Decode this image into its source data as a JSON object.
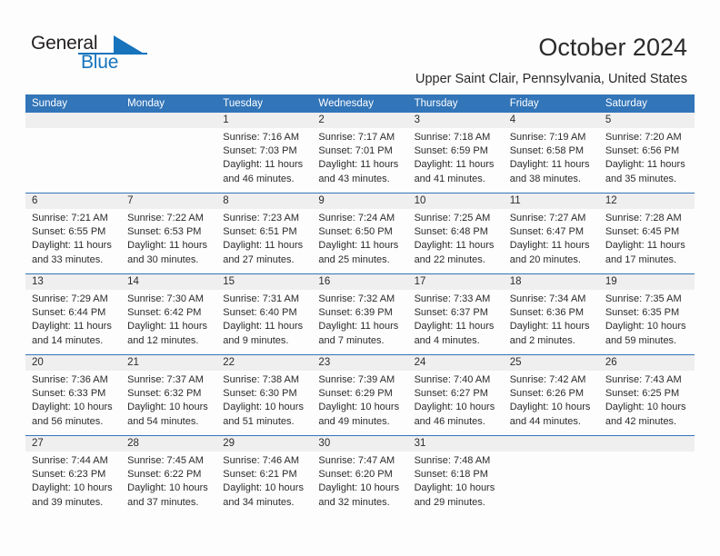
{
  "brand": {
    "name_part1": "General",
    "name_part2": "Blue"
  },
  "header": {
    "title": "October 2024",
    "location": "Upper Saint Clair, Pennsylvania, United States"
  },
  "colors": {
    "header_blue": "#3275b8",
    "brand_blue": "#1673bc",
    "daynum_strip": "#efefef",
    "text": "#2b2b2b"
  },
  "weekdays": [
    "Sunday",
    "Monday",
    "Tuesday",
    "Wednesday",
    "Thursday",
    "Friday",
    "Saturday"
  ],
  "weeks": [
    [
      {
        "day": "",
        "sunrise": "",
        "sunset": "",
        "daylight_1": "",
        "daylight_2": ""
      },
      {
        "day": "",
        "sunrise": "",
        "sunset": "",
        "daylight_1": "",
        "daylight_2": ""
      },
      {
        "day": "1",
        "sunrise": "Sunrise: 7:16 AM",
        "sunset": "Sunset: 7:03 PM",
        "daylight_1": "Daylight: 11 hours",
        "daylight_2": "and 46 minutes."
      },
      {
        "day": "2",
        "sunrise": "Sunrise: 7:17 AM",
        "sunset": "Sunset: 7:01 PM",
        "daylight_1": "Daylight: 11 hours",
        "daylight_2": "and 43 minutes."
      },
      {
        "day": "3",
        "sunrise": "Sunrise: 7:18 AM",
        "sunset": "Sunset: 6:59 PM",
        "daylight_1": "Daylight: 11 hours",
        "daylight_2": "and 41 minutes."
      },
      {
        "day": "4",
        "sunrise": "Sunrise: 7:19 AM",
        "sunset": "Sunset: 6:58 PM",
        "daylight_1": "Daylight: 11 hours",
        "daylight_2": "and 38 minutes."
      },
      {
        "day": "5",
        "sunrise": "Sunrise: 7:20 AM",
        "sunset": "Sunset: 6:56 PM",
        "daylight_1": "Daylight: 11 hours",
        "daylight_2": "and 35 minutes."
      }
    ],
    [
      {
        "day": "6",
        "sunrise": "Sunrise: 7:21 AM",
        "sunset": "Sunset: 6:55 PM",
        "daylight_1": "Daylight: 11 hours",
        "daylight_2": "and 33 minutes."
      },
      {
        "day": "7",
        "sunrise": "Sunrise: 7:22 AM",
        "sunset": "Sunset: 6:53 PM",
        "daylight_1": "Daylight: 11 hours",
        "daylight_2": "and 30 minutes."
      },
      {
        "day": "8",
        "sunrise": "Sunrise: 7:23 AM",
        "sunset": "Sunset: 6:51 PM",
        "daylight_1": "Daylight: 11 hours",
        "daylight_2": "and 27 minutes."
      },
      {
        "day": "9",
        "sunrise": "Sunrise: 7:24 AM",
        "sunset": "Sunset: 6:50 PM",
        "daylight_1": "Daylight: 11 hours",
        "daylight_2": "and 25 minutes."
      },
      {
        "day": "10",
        "sunrise": "Sunrise: 7:25 AM",
        "sunset": "Sunset: 6:48 PM",
        "daylight_1": "Daylight: 11 hours",
        "daylight_2": "and 22 minutes."
      },
      {
        "day": "11",
        "sunrise": "Sunrise: 7:27 AM",
        "sunset": "Sunset: 6:47 PM",
        "daylight_1": "Daylight: 11 hours",
        "daylight_2": "and 20 minutes."
      },
      {
        "day": "12",
        "sunrise": "Sunrise: 7:28 AM",
        "sunset": "Sunset: 6:45 PM",
        "daylight_1": "Daylight: 11 hours",
        "daylight_2": "and 17 minutes."
      }
    ],
    [
      {
        "day": "13",
        "sunrise": "Sunrise: 7:29 AM",
        "sunset": "Sunset: 6:44 PM",
        "daylight_1": "Daylight: 11 hours",
        "daylight_2": "and 14 minutes."
      },
      {
        "day": "14",
        "sunrise": "Sunrise: 7:30 AM",
        "sunset": "Sunset: 6:42 PM",
        "daylight_1": "Daylight: 11 hours",
        "daylight_2": "and 12 minutes."
      },
      {
        "day": "15",
        "sunrise": "Sunrise: 7:31 AM",
        "sunset": "Sunset: 6:40 PM",
        "daylight_1": "Daylight: 11 hours",
        "daylight_2": "and 9 minutes."
      },
      {
        "day": "16",
        "sunrise": "Sunrise: 7:32 AM",
        "sunset": "Sunset: 6:39 PM",
        "daylight_1": "Daylight: 11 hours",
        "daylight_2": "and 7 minutes."
      },
      {
        "day": "17",
        "sunrise": "Sunrise: 7:33 AM",
        "sunset": "Sunset: 6:37 PM",
        "daylight_1": "Daylight: 11 hours",
        "daylight_2": "and 4 minutes."
      },
      {
        "day": "18",
        "sunrise": "Sunrise: 7:34 AM",
        "sunset": "Sunset: 6:36 PM",
        "daylight_1": "Daylight: 11 hours",
        "daylight_2": "and 2 minutes."
      },
      {
        "day": "19",
        "sunrise": "Sunrise: 7:35 AM",
        "sunset": "Sunset: 6:35 PM",
        "daylight_1": "Daylight: 10 hours",
        "daylight_2": "and 59 minutes."
      }
    ],
    [
      {
        "day": "20",
        "sunrise": "Sunrise: 7:36 AM",
        "sunset": "Sunset: 6:33 PM",
        "daylight_1": "Daylight: 10 hours",
        "daylight_2": "and 56 minutes."
      },
      {
        "day": "21",
        "sunrise": "Sunrise: 7:37 AM",
        "sunset": "Sunset: 6:32 PM",
        "daylight_1": "Daylight: 10 hours",
        "daylight_2": "and 54 minutes."
      },
      {
        "day": "22",
        "sunrise": "Sunrise: 7:38 AM",
        "sunset": "Sunset: 6:30 PM",
        "daylight_1": "Daylight: 10 hours",
        "daylight_2": "and 51 minutes."
      },
      {
        "day": "23",
        "sunrise": "Sunrise: 7:39 AM",
        "sunset": "Sunset: 6:29 PM",
        "daylight_1": "Daylight: 10 hours",
        "daylight_2": "and 49 minutes."
      },
      {
        "day": "24",
        "sunrise": "Sunrise: 7:40 AM",
        "sunset": "Sunset: 6:27 PM",
        "daylight_1": "Daylight: 10 hours",
        "daylight_2": "and 46 minutes."
      },
      {
        "day": "25",
        "sunrise": "Sunrise: 7:42 AM",
        "sunset": "Sunset: 6:26 PM",
        "daylight_1": "Daylight: 10 hours",
        "daylight_2": "and 44 minutes."
      },
      {
        "day": "26",
        "sunrise": "Sunrise: 7:43 AM",
        "sunset": "Sunset: 6:25 PM",
        "daylight_1": "Daylight: 10 hours",
        "daylight_2": "and 42 minutes."
      }
    ],
    [
      {
        "day": "27",
        "sunrise": "Sunrise: 7:44 AM",
        "sunset": "Sunset: 6:23 PM",
        "daylight_1": "Daylight: 10 hours",
        "daylight_2": "and 39 minutes."
      },
      {
        "day": "28",
        "sunrise": "Sunrise: 7:45 AM",
        "sunset": "Sunset: 6:22 PM",
        "daylight_1": "Daylight: 10 hours",
        "daylight_2": "and 37 minutes."
      },
      {
        "day": "29",
        "sunrise": "Sunrise: 7:46 AM",
        "sunset": "Sunset: 6:21 PM",
        "daylight_1": "Daylight: 10 hours",
        "daylight_2": "and 34 minutes."
      },
      {
        "day": "30",
        "sunrise": "Sunrise: 7:47 AM",
        "sunset": "Sunset: 6:20 PM",
        "daylight_1": "Daylight: 10 hours",
        "daylight_2": "and 32 minutes."
      },
      {
        "day": "31",
        "sunrise": "Sunrise: 7:48 AM",
        "sunset": "Sunset: 6:18 PM",
        "daylight_1": "Daylight: 10 hours",
        "daylight_2": "and 29 minutes."
      },
      {
        "day": "",
        "sunrise": "",
        "sunset": "",
        "daylight_1": "",
        "daylight_2": ""
      },
      {
        "day": "",
        "sunrise": "",
        "sunset": "",
        "daylight_1": "",
        "daylight_2": ""
      }
    ]
  ]
}
